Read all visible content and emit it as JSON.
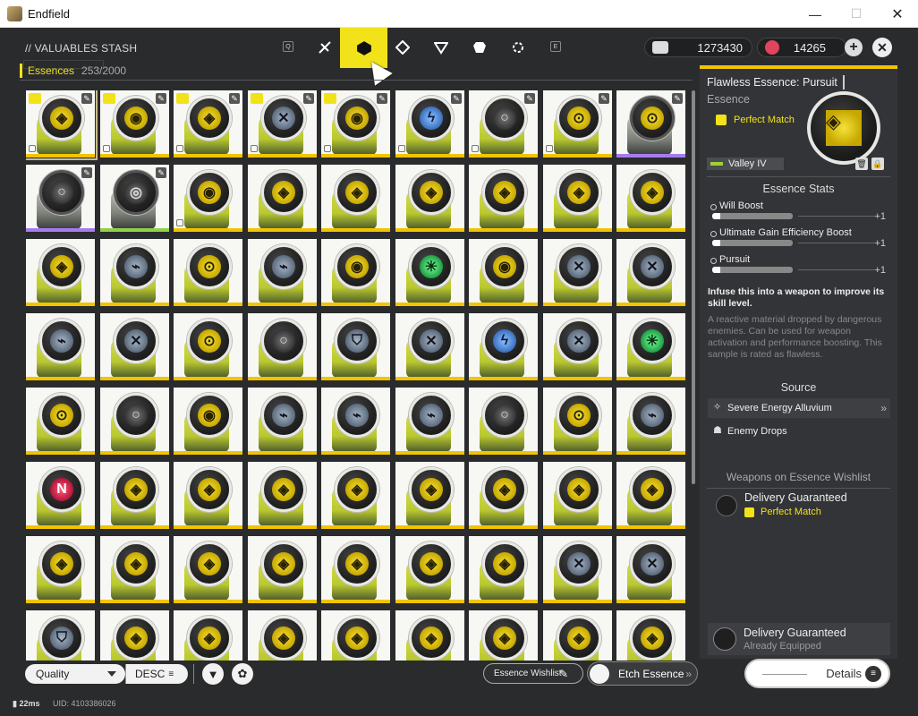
{
  "window": {
    "title": "Endfield",
    "min": "—",
    "max": "☐",
    "close": "✕"
  },
  "header": {
    "stash_title": "// VALUABLES STASH",
    "key_left": "Q",
    "key_right": "E",
    "currency1": "1273430",
    "currency2": "14265",
    "plus": "+",
    "close": "✕"
  },
  "category": {
    "name": "Essences",
    "count": "253/2000"
  },
  "colors": {
    "accent": "#f2e21a",
    "rarity_gold": "#f2c400",
    "rarity_purple": "#a57cf0",
    "rarity_green": "#8fd14b"
  },
  "grid": {
    "items": [
      {
        "g": "◈",
        "c": "g-yellow",
        "r": "gold",
        "badge": true,
        "pin": true,
        "lock": true,
        "sel": true
      },
      {
        "g": "◉",
        "c": "g-yellow",
        "r": "gold",
        "badge": true,
        "pin": true,
        "lock": true
      },
      {
        "g": "◈",
        "c": "g-yellow",
        "r": "gold",
        "badge": true,
        "pin": true,
        "lock": true
      },
      {
        "g": "✕",
        "c": "g-steel",
        "r": "gold",
        "badge": true,
        "pin": true,
        "lock": true
      },
      {
        "g": "◉",
        "c": "g-yellow",
        "r": "gold",
        "badge": true,
        "pin": true,
        "lock": true
      },
      {
        "g": "ϟ",
        "c": "g-blue",
        "r": "gold",
        "pin": true,
        "lock": true
      },
      {
        "g": "○",
        "c": "g-gray",
        "r": "gold",
        "pin": true,
        "lock": true
      },
      {
        "g": "⊙",
        "c": "g-yellow",
        "r": "gold",
        "pin": true,
        "lock": true
      },
      {
        "g": "⊙",
        "c": "g-yellow",
        "r": "purple",
        "pin": true,
        "dark": true
      },
      {
        "g": "○",
        "c": "g-gray",
        "r": "purple",
        "pin": true,
        "dark": true
      },
      {
        "g": "◎",
        "c": "g-gray",
        "r": "green",
        "pin": true,
        "dark": true
      },
      {
        "g": "◉",
        "c": "g-yellow",
        "r": "gold",
        "lock": true
      },
      {
        "g": "◈",
        "c": "g-yellow",
        "r": "gold"
      },
      {
        "g": "◈",
        "c": "g-yellow",
        "r": "gold"
      },
      {
        "g": "◈",
        "c": "g-yellow",
        "r": "gold"
      },
      {
        "g": "◈",
        "c": "g-yellow",
        "r": "gold"
      },
      {
        "g": "◈",
        "c": "g-yellow",
        "r": "gold"
      },
      {
        "g": "◈",
        "c": "g-yellow",
        "r": "gold"
      },
      {
        "g": "◈",
        "c": "g-yellow",
        "r": "gold"
      },
      {
        "g": "⌁",
        "c": "g-steel",
        "r": "gold"
      },
      {
        "g": "⊙",
        "c": "g-yellow",
        "r": "gold"
      },
      {
        "g": "⌁",
        "c": "g-steel",
        "r": "gold"
      },
      {
        "g": "◉",
        "c": "g-yellow",
        "r": "gold"
      },
      {
        "g": "✳",
        "c": "g-green",
        "r": "gold"
      },
      {
        "g": "◉",
        "c": "g-yellow",
        "r": "gold"
      },
      {
        "g": "✕",
        "c": "g-steel",
        "r": "gold"
      },
      {
        "g": "✕",
        "c": "g-steel",
        "r": "gold"
      },
      {
        "g": "⌁",
        "c": "g-steel",
        "r": "gold"
      },
      {
        "g": "✕",
        "c": "g-steel",
        "r": "gold"
      },
      {
        "g": "⊙",
        "c": "g-yellow",
        "r": "gold"
      },
      {
        "g": "○",
        "c": "g-gray",
        "r": "gold"
      },
      {
        "g": "⛉",
        "c": "g-steel",
        "r": "gold"
      },
      {
        "g": "✕",
        "c": "g-steel",
        "r": "gold"
      },
      {
        "g": "ϟ",
        "c": "g-blue",
        "r": "gold"
      },
      {
        "g": "✕",
        "c": "g-steel",
        "r": "gold"
      },
      {
        "g": "✳",
        "c": "g-green",
        "r": "gold"
      },
      {
        "g": "⊙",
        "c": "g-yellow",
        "r": "gold"
      },
      {
        "g": "○",
        "c": "g-gray",
        "r": "gold"
      },
      {
        "g": "◉",
        "c": "g-yellow",
        "r": "gold"
      },
      {
        "g": "⌁",
        "c": "g-steel",
        "r": "gold"
      },
      {
        "g": "⌁",
        "c": "g-steel",
        "r": "gold"
      },
      {
        "g": "⌁",
        "c": "g-steel",
        "r": "gold"
      },
      {
        "g": "○",
        "c": "g-gray",
        "r": "gold"
      },
      {
        "g": "⊙",
        "c": "g-yellow",
        "r": "gold"
      },
      {
        "g": "⌁",
        "c": "g-steel",
        "r": "gold"
      },
      {
        "g": "N",
        "c": "g-pink",
        "r": "gold"
      },
      {
        "g": "◈",
        "c": "g-yellow",
        "r": "gold"
      },
      {
        "g": "◈",
        "c": "g-yellow",
        "r": "gold"
      },
      {
        "g": "◈",
        "c": "g-yellow",
        "r": "gold"
      },
      {
        "g": "◈",
        "c": "g-yellow",
        "r": "gold"
      },
      {
        "g": "◈",
        "c": "g-yellow",
        "r": "gold"
      },
      {
        "g": "◈",
        "c": "g-yellow",
        "r": "gold"
      },
      {
        "g": "◈",
        "c": "g-yellow",
        "r": "gold"
      },
      {
        "g": "◈",
        "c": "g-yellow",
        "r": "gold"
      },
      {
        "g": "◈",
        "c": "g-yellow",
        "r": "gold"
      },
      {
        "g": "◈",
        "c": "g-yellow",
        "r": "gold"
      },
      {
        "g": "◈",
        "c": "g-yellow",
        "r": "gold"
      },
      {
        "g": "◈",
        "c": "g-yellow",
        "r": "gold"
      },
      {
        "g": "◈",
        "c": "g-yellow",
        "r": "gold"
      },
      {
        "g": "◈",
        "c": "g-yellow",
        "r": "gold"
      },
      {
        "g": "◈",
        "c": "g-yellow",
        "r": "gold"
      },
      {
        "g": "✕",
        "c": "g-steel",
        "r": "gold"
      },
      {
        "g": "✕",
        "c": "g-steel",
        "r": "gold"
      },
      {
        "g": "⛉",
        "c": "g-steel",
        "r": "gold"
      },
      {
        "g": "◈",
        "c": "g-yellow",
        "r": "gold"
      },
      {
        "g": "◈",
        "c": "g-yellow",
        "r": "gold"
      },
      {
        "g": "◈",
        "c": "g-yellow",
        "r": "gold"
      },
      {
        "g": "◈",
        "c": "g-yellow",
        "r": "gold"
      },
      {
        "g": "◈",
        "c": "g-yellow",
        "r": "gold"
      },
      {
        "g": "◈",
        "c": "g-yellow",
        "r": "gold"
      },
      {
        "g": "◈",
        "c": "g-yellow",
        "r": "gold"
      },
      {
        "g": "◈",
        "c": "g-yellow",
        "r": "gold"
      }
    ]
  },
  "toolbar": {
    "sort_label": "Quality",
    "sort_dir": "DESC",
    "filter_icon": "filter-icon",
    "wishlist_label": "Essence Wishlist",
    "etch_label": "Etch Essence",
    "details_label": "Details"
  },
  "status": {
    "ping": "22ms",
    "uid": "UID: 4103386026"
  },
  "detail": {
    "title": "Flawless Essence: Pursuit",
    "type": "Essence",
    "match": "Perfect Match",
    "location": "Valley IV",
    "stats_heading": "Essence Stats",
    "stats": [
      {
        "name": "Will Boost",
        "level": "+1",
        "fill": 0.1
      },
      {
        "name": "Ultimate Gain Efficiency Boost",
        "level": "+1",
        "fill": 0.1
      },
      {
        "name": "Pursuit",
        "level": "+1",
        "fill": 0.1
      }
    ],
    "description": "Infuse this into a weapon to improve its skill level.",
    "lore": "A reactive material dropped by dangerous enemies. Can be used for weapon activation and performance boosting. This sample is rated as flawless.",
    "source_heading": "Source",
    "sources": [
      {
        "label": "Severe Energy Alluvium",
        "chev": "»"
      },
      {
        "label": "Enemy Drops",
        "chev": ""
      }
    ],
    "wishlist_heading": "Weapons on Essence Wishlist",
    "wishlist_item": {
      "name": "Delivery Guaranteed",
      "match": "Perfect Match"
    },
    "equipped": {
      "name": "Delivery Guaranteed",
      "status": "Already Equipped"
    }
  }
}
